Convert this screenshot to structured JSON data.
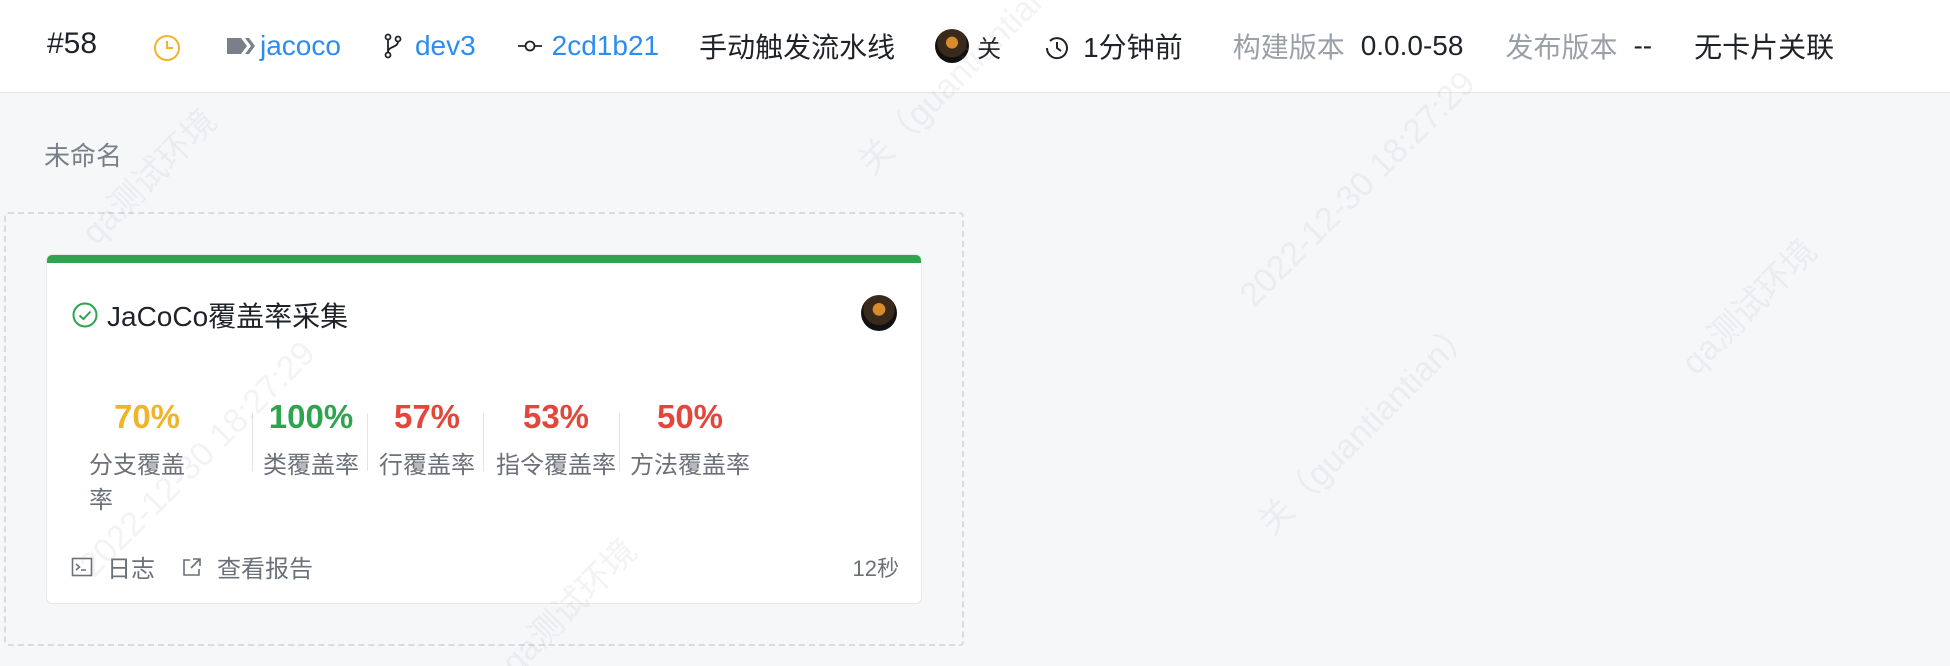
{
  "header": {
    "run_number": "#58",
    "pipeline": "jacoco",
    "branch": "dev3",
    "commit": "2cd1b21",
    "trigger": "手动触发流水线",
    "user": "关",
    "time": "1分钟前",
    "build_version_label": "构建版本",
    "build_version": "0.0.0-58",
    "release_version_label": "发布版本",
    "release_version": "--",
    "card_link": "无卡片关联"
  },
  "stage": {
    "title": "未命名",
    "job": {
      "title": "JaCoCo覆盖率采集",
      "status_color": "#2ea44f",
      "metrics": [
        {
          "value": "70%",
          "label": "分支覆盖率",
          "color": "#f0b429"
        },
        {
          "value": "100%",
          "label": "类覆盖率",
          "color": "#2ea44f"
        },
        {
          "value": "57%",
          "label": "行覆盖率",
          "color": "#e5463b"
        },
        {
          "value": "53%",
          "label": "指令覆盖率",
          "color": "#e5463b"
        },
        {
          "value": "50%",
          "label": "方法覆盖率",
          "color": "#e5463b"
        }
      ],
      "log_label": "日志",
      "report_label": "查看报告",
      "duration": "12秒"
    }
  },
  "watermarks": [
    "qa测试环境",
    "关（guantiantian）",
    "2022-12-30 18:27:29"
  ],
  "colors": {
    "link": "#2d8cf0",
    "success": "#2ea44f",
    "warning": "#f0b429",
    "danger": "#e5463b"
  }
}
